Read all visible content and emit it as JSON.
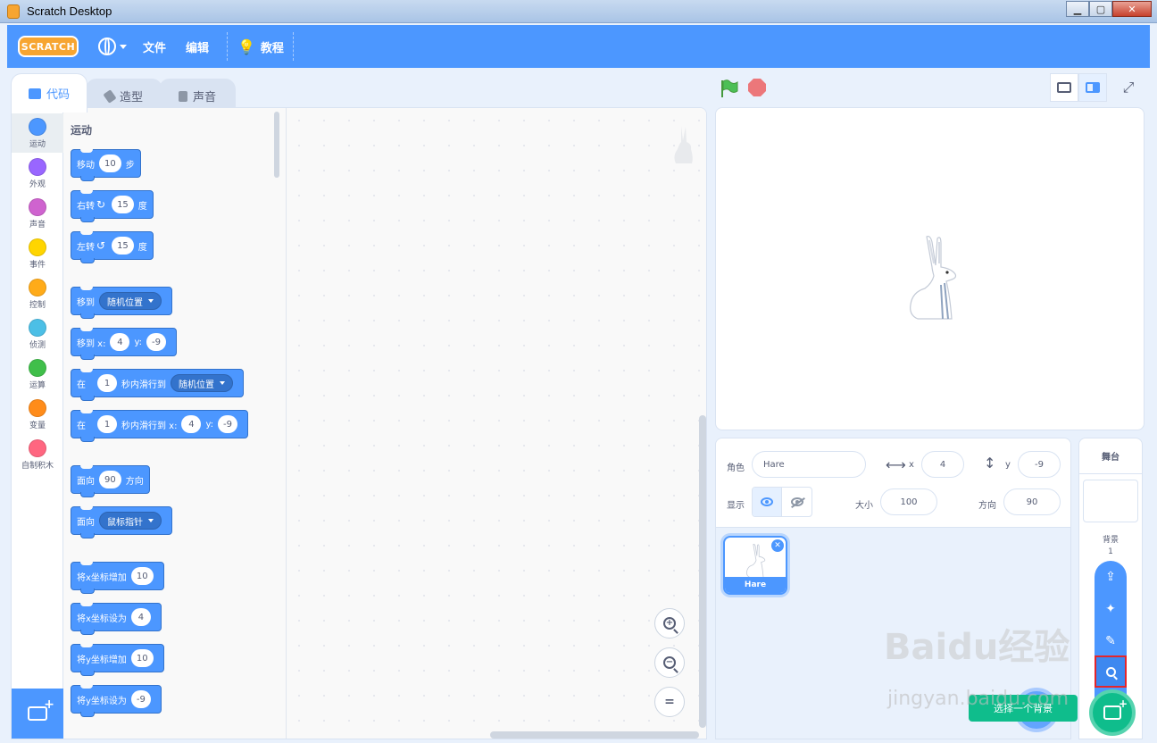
{
  "window": {
    "title": "Scratch Desktop"
  },
  "menubar": {
    "logo": "SCRATCH",
    "file": "文件",
    "edit": "编辑",
    "tutorials": "教程"
  },
  "tabs": {
    "code": "代码",
    "costumes": "造型",
    "sounds": "声音"
  },
  "categories": [
    {
      "label": "运动",
      "color": "#4c97ff"
    },
    {
      "label": "外观",
      "color": "#9966ff"
    },
    {
      "label": "声音",
      "color": "#cf63cf"
    },
    {
      "label": "事件",
      "color": "#ffd500"
    },
    {
      "label": "控制",
      "color": "#ffab19"
    },
    {
      "label": "侦测",
      "color": "#4cbfe6"
    },
    {
      "label": "运算",
      "color": "#40bf4a"
    },
    {
      "label": "变量",
      "color": "#ff8c1a"
    },
    {
      "label": "自制积木",
      "color": "#ff6680"
    }
  ],
  "palette": {
    "section_title": "运动",
    "blocks": {
      "move": {
        "pre": "移动",
        "val": "10",
        "post": "步"
      },
      "turn_right": {
        "pre": "右转",
        "val": "15",
        "post": "度"
      },
      "turn_left": {
        "pre": "左转",
        "val": "15",
        "post": "度"
      },
      "goto": {
        "pre": "移到",
        "dd": "随机位置"
      },
      "goto_xy": {
        "pre": "移到 x:",
        "x": "4",
        "ylabel": "y:",
        "y": "-9"
      },
      "glide": {
        "pre": "在",
        "secs": "1",
        "mid": "秒内滑行到",
        "dd": "随机位置"
      },
      "glide_xy": {
        "pre": "在",
        "secs": "1",
        "mid": "秒内滑行到 x:",
        "x": "4",
        "ylabel": "y:",
        "y": "-9"
      },
      "point_dir": {
        "pre": "面向",
        "val": "90",
        "post": "方向"
      },
      "point_towards": {
        "pre": "面向",
        "dd": "鼠标指针"
      },
      "change_x": {
        "pre": "将x坐标增加",
        "val": "10"
      },
      "set_x": {
        "pre": "将x坐标设为",
        "val": "4"
      },
      "change_y": {
        "pre": "将y坐标增加",
        "val": "10"
      },
      "set_y": {
        "pre": "将y坐标设为",
        "val": "-9"
      }
    }
  },
  "sprite_info": {
    "sprite_label": "角色",
    "sprite_name": "Hare",
    "x_label": "x",
    "x": "4",
    "y_label": "y",
    "y": "-9",
    "show_label": "显示",
    "size_label": "大小",
    "size": "100",
    "direction_label": "方向",
    "direction": "90"
  },
  "sprites": [
    {
      "name": "Hare"
    }
  ],
  "stage_pane": {
    "title": "舞台",
    "backdrops_label": "背景",
    "backdrops_count": "1"
  },
  "tooltip": {
    "text": "选择一个背景"
  },
  "watermark": {
    "brand": "Baidu经验",
    "url": "jingyan.baidu.com"
  }
}
